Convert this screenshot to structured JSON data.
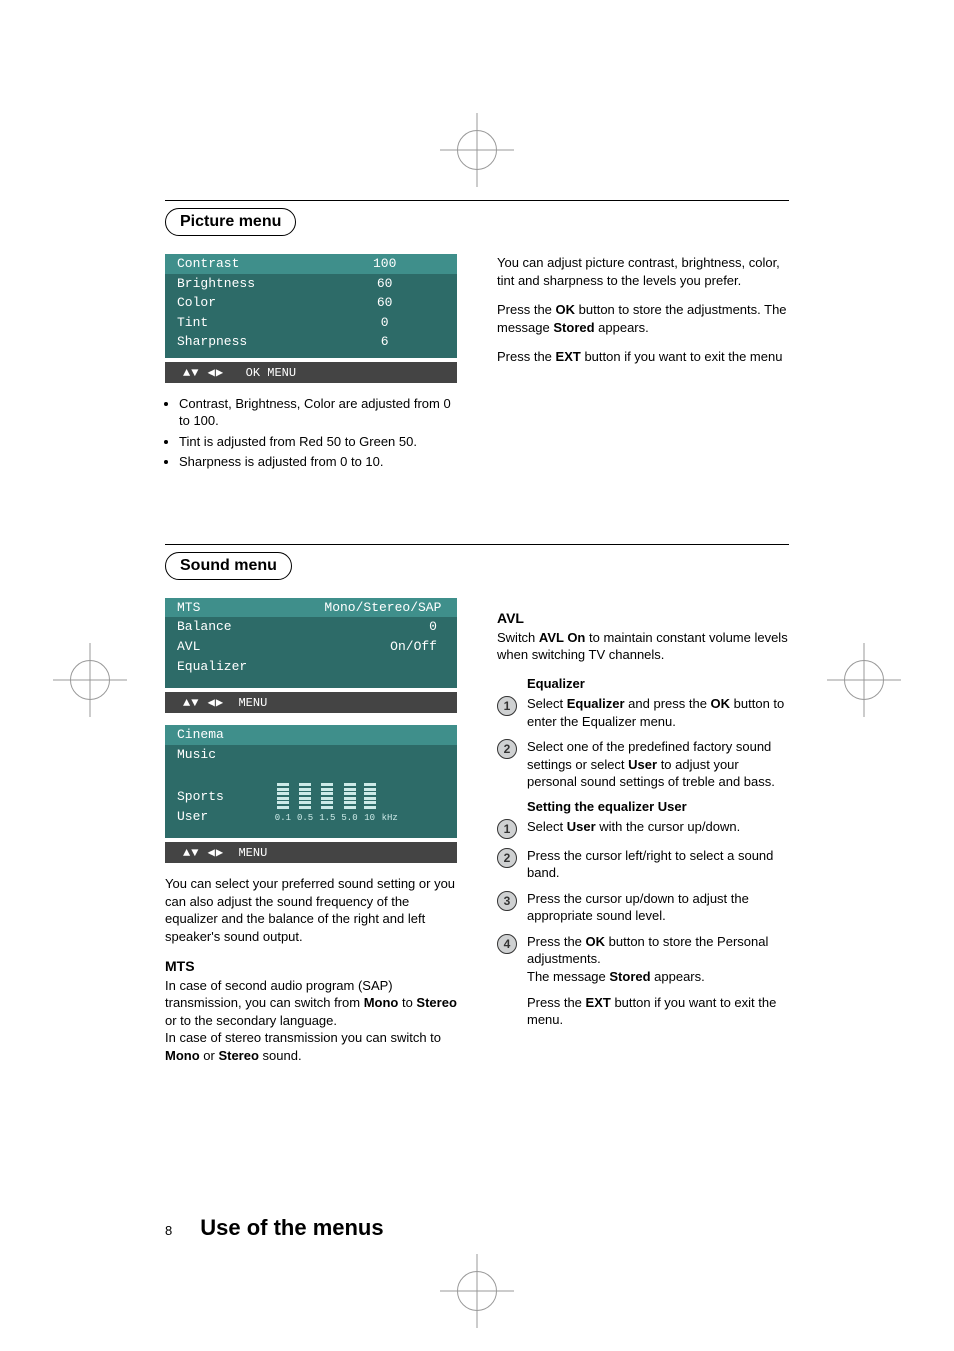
{
  "sections": {
    "picture": {
      "title": "Picture menu",
      "menu": {
        "items": [
          {
            "label": "Contrast",
            "value": "100",
            "highlight": true
          },
          {
            "label": "Brightness",
            "value": "60",
            "highlight": false
          },
          {
            "label": "Color",
            "value": "60",
            "highlight": false
          },
          {
            "label": "Tint",
            "value": "0",
            "highlight": false
          },
          {
            "label": "Sharpness",
            "value": "6",
            "highlight": false
          }
        ],
        "hint_arrows": "▲▼ ◀▶",
        "hint_text": "OK MENU"
      },
      "bullets": [
        "Contrast, Brightness, Color are adjusted from 0 to 100.",
        "Tint is adjusted from Red 50 to Green 50.",
        "Sharpness is adjusted from 0 to 10."
      ],
      "right": {
        "intro": "You can adjust picture contrast, brightness, color, tint and sharpness to the levels you prefer.",
        "store_pre": "Press the ",
        "store_bold": "OK",
        "store_mid": " button to store the adjustments. The message ",
        "store_bold2": "Stored",
        "store_post": " appears.",
        "exit_pre": "Press the ",
        "exit_bold": "EXT",
        "exit_post": " button if you want to exit the menu"
      }
    },
    "sound": {
      "title": "Sound menu",
      "menu1": {
        "items": [
          {
            "label": "MTS",
            "value": "Mono/Stereo/SAP",
            "highlight": true
          },
          {
            "label": "Balance",
            "value": "0",
            "highlight": false
          },
          {
            "label": "AVL",
            "value": "On/Off",
            "highlight": false
          },
          {
            "label": "Equalizer",
            "value": "",
            "highlight": false
          }
        ],
        "hint_arrows": "▲▼ ◀▶",
        "hint_text": "MENU"
      },
      "menu2": {
        "items": [
          {
            "label": "Cinema",
            "highlight": true
          },
          {
            "label": "Music",
            "highlight": false
          },
          {
            "label": "Sports",
            "highlight": false
          },
          {
            "label": "User",
            "highlight": false
          }
        ],
        "eq_labels": [
          "0.1",
          "0.5",
          "1.5",
          "5.0",
          "10",
          "kHz"
        ],
        "hint_arrows": "▲▼ ◀▶",
        "hint_text": "MENU"
      },
      "left_para": "You can select your preferred sound setting or you can also adjust the sound frequency of the equalizer and the balance of the right and left speaker's sound output.",
      "mts_heading": "MTS",
      "mts_p1a": "In case of second audio program (SAP) transmission, you can switch from ",
      "mts_p1b": "Mono",
      "mts_p1c": " to ",
      "mts_p1d": "Stereo",
      "mts_p1e": " or to the secondary language.",
      "mts_p2a": "In case of stereo transmission you can switch to ",
      "mts_p2b": "Mono",
      "mts_p2c": " or ",
      "mts_p2d": "Stereo",
      "mts_p2e": " sound.",
      "right": {
        "avl_heading": "AVL",
        "avl_pre": "Switch ",
        "avl_bold": "AVL On",
        "avl_post": " to maintain constant volume levels when switching TV channels.",
        "eq_heading": "Equalizer",
        "eq_step1_pre": "Select ",
        "eq_step1_bold": "Equalizer",
        "eq_step1_mid": " and press the ",
        "eq_step1_bold2": "OK",
        "eq_step1_post": " button to enter the Equalizer menu.",
        "eq_step2_pre": "Select one of the predefined factory sound settings or select ",
        "eq_step2_bold": "User",
        "eq_step2_post": " to adjust your personal sound settings of treble and bass.",
        "setuser_heading": "Setting the equalizer User",
        "su1_pre": "Select ",
        "su1_bold": "User",
        "su1_post": " with the cursor up/down.",
        "su2": "Press the cursor left/right to select a sound band.",
        "su3": "Press the cursor up/down to adjust the appropriate sound level.",
        "su4_pre": "Press the ",
        "su4_bold": "OK",
        "su4_mid": " button to store the Personal adjustments.",
        "su4_line2_pre": "The message ",
        "su4_line2_bold": "Stored",
        "su4_line2_post": " appears.",
        "exit_pre": "Press the ",
        "exit_bold": "EXT",
        "exit_post": " button if you want to exit the menu."
      }
    }
  },
  "footer": {
    "page_num": "8",
    "title": "Use of the menus"
  }
}
